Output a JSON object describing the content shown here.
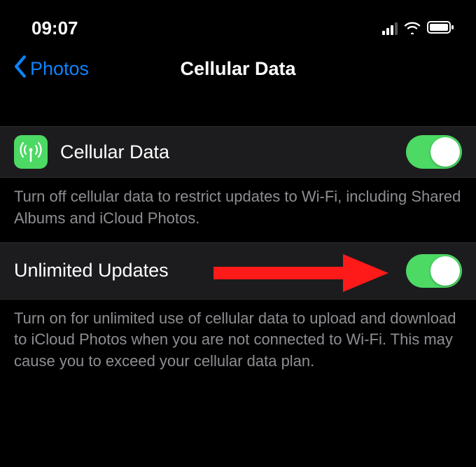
{
  "status": {
    "time": "09:07"
  },
  "nav": {
    "back_label": "Photos",
    "title": "Cellular Data"
  },
  "rows": {
    "cellular": {
      "label": "Cellular Data",
      "footer": "Turn off cellular data to restrict updates to Wi-Fi, including Shared Albums and iCloud Photos.",
      "on": true
    },
    "unlimited": {
      "label": "Unlimited Updates",
      "footer": "Turn on for unlimited use of cellular data to upload and download to iCloud Photos when you are not connected to Wi-Fi. This may cause you to exceed your cellular data plan.",
      "on": true
    }
  }
}
